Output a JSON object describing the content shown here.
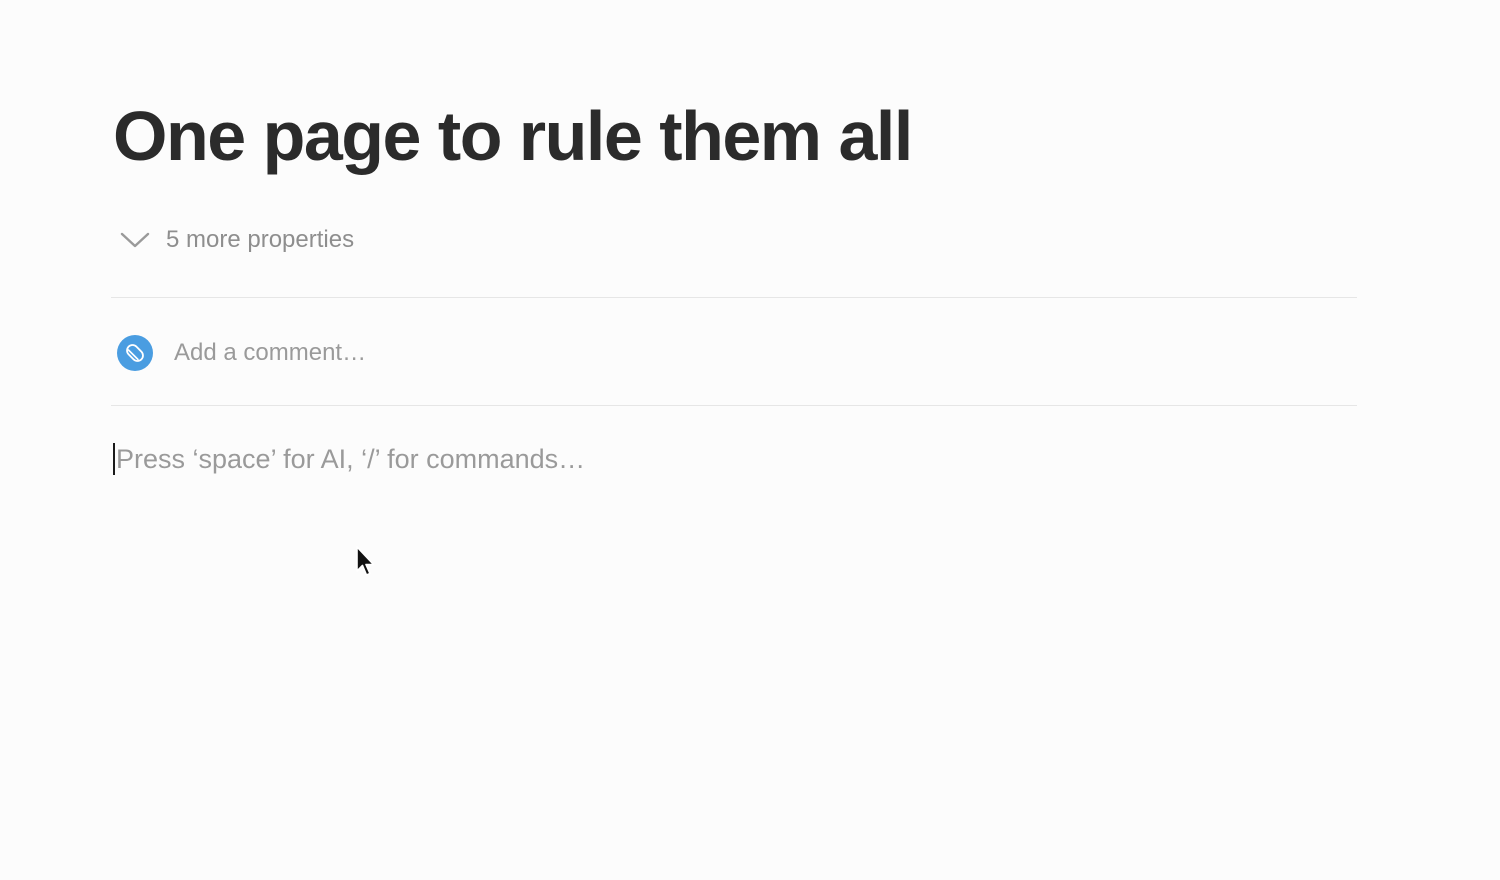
{
  "page": {
    "title": "One page to rule them all"
  },
  "properties": {
    "toggle_label": "5 more properties",
    "toggle_icon": "chevron-down-icon"
  },
  "comment": {
    "placeholder": "Add a comment…",
    "avatar_icon": "workspace-logo-icon",
    "avatar_color": "#4a9de1"
  },
  "editor": {
    "placeholder": "Press ‘space’ for AI, ‘/’ for commands…"
  },
  "colors": {
    "background": "#fcfcfc",
    "title": "#2b2b2b",
    "muted_text": "#8e8e8e",
    "divider": "#e6e6e6"
  }
}
